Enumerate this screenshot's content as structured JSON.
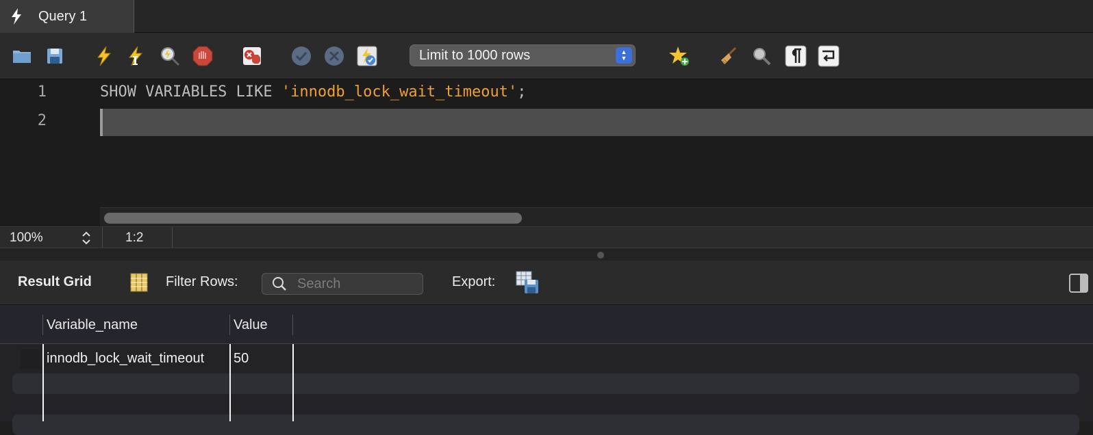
{
  "tab": {
    "label": "Query 1",
    "icon": "lightning-icon"
  },
  "toolbar": {
    "limit_select": "Limit to 1000 rows",
    "buttons": [
      "open-folder-icon",
      "save-icon",
      "execute-icon",
      "execute-current-icon",
      "explain-icon",
      "stop-icon",
      "toggle-error-stop-icon",
      "commit-icon",
      "rollback-icon",
      "autocommit-icon",
      "add-snippet-icon",
      "beautify-icon",
      "find-icon",
      "invisible-chars-icon",
      "wrap-lines-icon"
    ]
  },
  "editor": {
    "lines": [
      {
        "num": "1",
        "keyword": "SHOW VARIABLES LIKE ",
        "string": "'innodb_lock_wait_timeout'",
        "punct": ";"
      },
      {
        "num": "2",
        "keyword": "",
        "string": "",
        "punct": ""
      }
    ]
  },
  "status": {
    "zoom": "100%",
    "cursor": "1:2"
  },
  "results": {
    "title": "Result Grid",
    "filter_label": "Filter Rows:",
    "search_placeholder": "Search",
    "export_label": "Export:",
    "columns": [
      "Variable_name",
      "Value"
    ],
    "rows": [
      {
        "variable_name": "innodb_lock_wait_timeout",
        "value": "50"
      }
    ]
  },
  "colors": {
    "accent": "#3b6fd9",
    "string": "#f0a030",
    "keyword": "#bdbdbd"
  }
}
